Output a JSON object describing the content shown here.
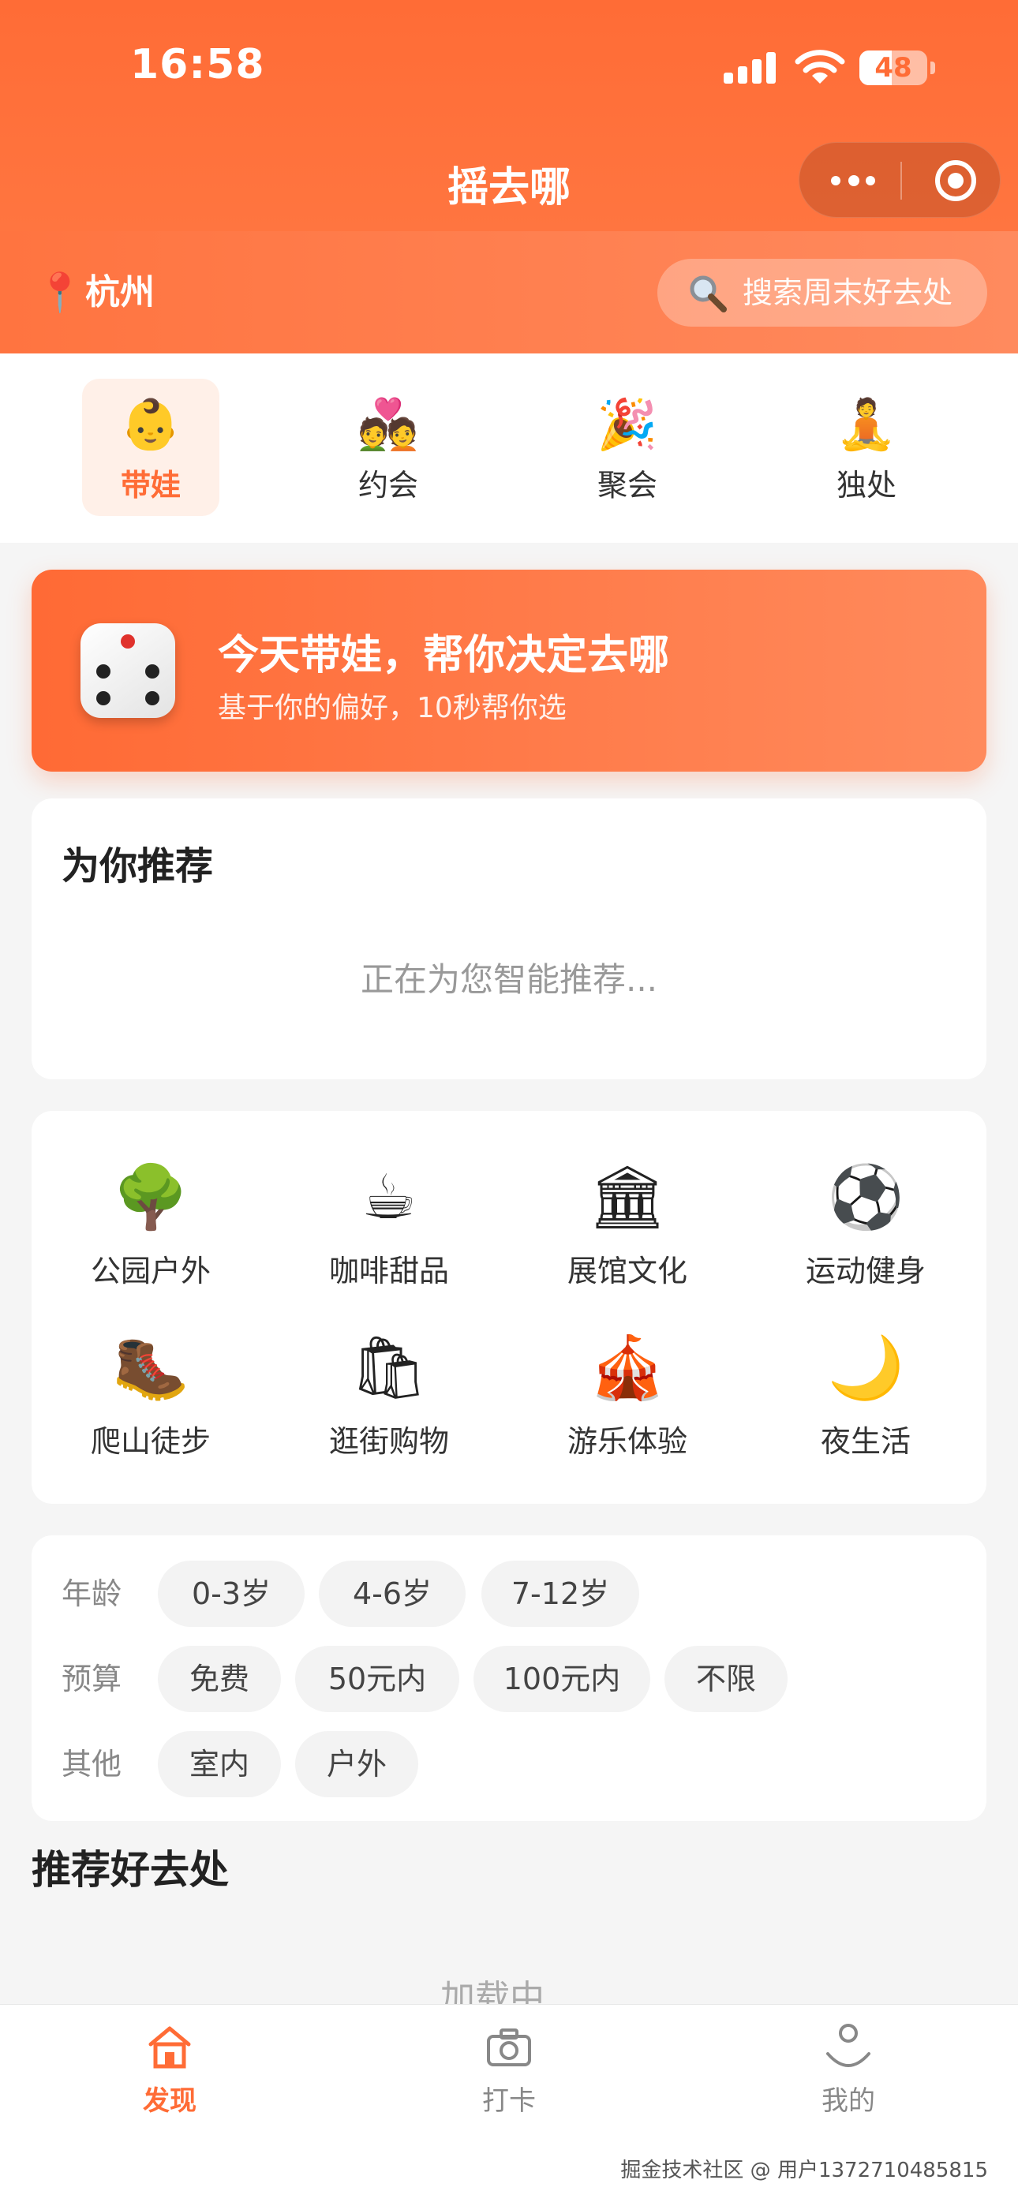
{
  "status_bar": {
    "time": "16:58",
    "battery": "48",
    "battery_level": 0.48
  },
  "header": {
    "title": "摇去哪"
  },
  "location": {
    "city": "杭州",
    "pin_icon": "📍"
  },
  "search": {
    "placeholder": "搜索周末好去处"
  },
  "categories": [
    {
      "emoji": "👶",
      "label": "带娃",
      "active": true
    },
    {
      "emoji": "💑",
      "label": "约会",
      "active": false
    },
    {
      "emoji": "🎉",
      "label": "聚会",
      "active": false
    },
    {
      "emoji": "🧘",
      "label": "独处",
      "active": false
    }
  ],
  "banner": {
    "title": "今天带娃，帮你决定去哪",
    "subtitle": "基于你的偏好，10秒帮你选"
  },
  "recommend": {
    "title": "为你推荐",
    "loading": "正在为您智能推荐..."
  },
  "grid": [
    {
      "emoji": "🌳",
      "label": "公园户外"
    },
    {
      "emoji": "☕",
      "label": "咖啡甜品"
    },
    {
      "emoji": "🏛",
      "label": "展馆文化"
    },
    {
      "emoji": "⚽",
      "label": "运动健身"
    },
    {
      "emoji": "🥾",
      "label": "爬山徒步"
    },
    {
      "emoji": "🛍",
      "label": "逛街购物"
    },
    {
      "emoji": "🎪",
      "label": "游乐体验"
    },
    {
      "emoji": "🌙",
      "label": "夜生活"
    }
  ],
  "filters": {
    "age": {
      "label": "年龄",
      "options": [
        "0-3岁",
        "4-6岁",
        "7-12岁"
      ]
    },
    "budget": {
      "label": "预算",
      "options": [
        "免费",
        "50元内",
        "100元内",
        "不限"
      ]
    },
    "other": {
      "label": "其他",
      "options": [
        "室内",
        "户外"
      ]
    }
  },
  "places": {
    "title": "推荐好去处",
    "loading": "加载中..."
  },
  "tabbar": [
    {
      "label": "发现",
      "icon": "home-icon",
      "active": true
    },
    {
      "label": "打卡",
      "icon": "camera-icon",
      "active": false
    },
    {
      "label": "我的",
      "icon": "user-icon",
      "active": false
    }
  ],
  "watermark": "掘金技术社区 @ 用户1372710485815",
  "colors": {
    "accent": "#ff6c36",
    "accent_light": "#fff0e8",
    "background": "#f5f5f5"
  }
}
